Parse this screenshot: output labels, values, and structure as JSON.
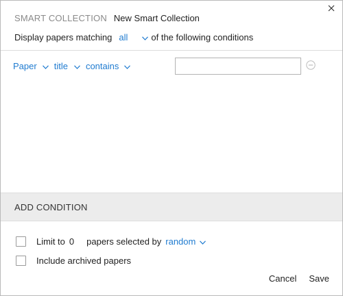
{
  "header": {
    "label": "SMART COLLECTION",
    "name": "New Smart Collection",
    "match_prefix": "Display papers matching",
    "match_value": "all",
    "match_suffix": "of the following conditions"
  },
  "condition": {
    "field": "Paper",
    "attribute": "title",
    "operator": "contains",
    "value": ""
  },
  "add_condition_label": "ADD CONDITION",
  "limit": {
    "prefix": "Limit to",
    "count": "0",
    "middle": "papers selected by",
    "order": "random",
    "checked": false
  },
  "archived": {
    "label": "Include archived papers",
    "checked": false
  },
  "footer": {
    "cancel": "Cancel",
    "save": "Save"
  },
  "colors": {
    "link": "#1f7bd0",
    "header_label": "#8a8a8a",
    "add_bar": "#ececec"
  }
}
